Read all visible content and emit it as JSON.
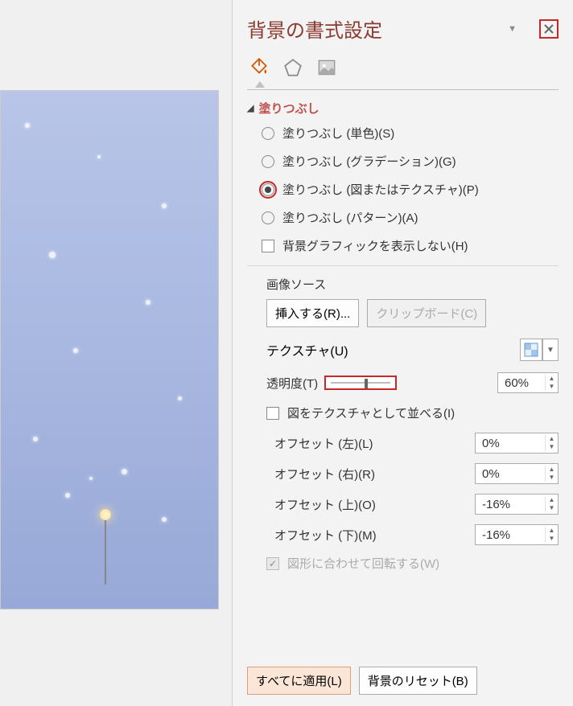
{
  "panel": {
    "title": "背景の書式設定",
    "section_fill": "塗りつぶし",
    "fill_options": {
      "solid": "塗りつぶし (単色)(S)",
      "gradient": "塗りつぶし (グラデーション)(G)",
      "picture": "塗りつぶし (図またはテクスチャ)(P)",
      "pattern": "塗りつぶし (パターン)(A)"
    },
    "hide_bg_graphics": "背景グラフィックを表示しない(H)",
    "image_source": "画像ソース",
    "insert": "挿入する(R)...",
    "clipboard": "クリップボード(C)",
    "texture_label": "テクスチャ(U)",
    "transparency_label": "透明度(T)",
    "transparency_value": "60%",
    "tile_as_texture": "図をテクスチャとして並べる(I)",
    "offset_left_label": "オフセット (左)(L)",
    "offset_left_value": "0%",
    "offset_right_label": "オフセット (右)(R)",
    "offset_right_value": "0%",
    "offset_top_label": "オフセット (上)(O)",
    "offset_top_value": "-16%",
    "offset_bottom_label": "オフセット (下)(M)",
    "offset_bottom_value": "-16%",
    "rotate_with_shape": "図形に合わせて回転する(W)",
    "apply_all": "すべてに適用(L)",
    "reset_bg": "背景のリセット(B)"
  }
}
